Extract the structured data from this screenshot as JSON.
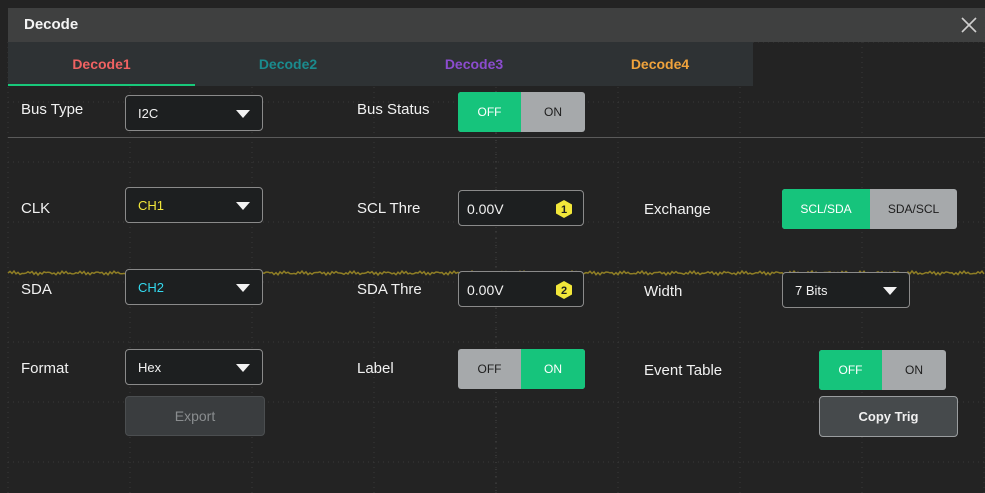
{
  "window": {
    "title": "Decode"
  },
  "tabs": [
    {
      "label": "Decode1",
      "color": "#f06262",
      "active": true
    },
    {
      "label": "Decode2",
      "color": "#1a8b8e",
      "active": false
    },
    {
      "label": "Decode3",
      "color": "#8c4ccf",
      "active": false
    },
    {
      "label": "Decode4",
      "color": "#f0a33c",
      "active": false
    }
  ],
  "rows": {
    "bus_type": {
      "label": "Bus Type",
      "value": "I2C"
    },
    "bus_status": {
      "label": "Bus Status",
      "off": "OFF",
      "on": "ON",
      "state": "OFF"
    },
    "clk": {
      "label": "CLK",
      "value": "CH1",
      "value_color": "#f2e73a"
    },
    "scl_thre": {
      "label": "SCL Thre",
      "value": "0.00V",
      "badge": "1",
      "badge_color": "#f2e73a"
    },
    "exchange": {
      "label": "Exchange",
      "opt1": "SCL/SDA",
      "opt2": "SDA/SCL",
      "state": "SCL/SDA"
    },
    "sda": {
      "label": "SDA",
      "value": "CH2",
      "value_color": "#33d9ee"
    },
    "sda_thre": {
      "label": "SDA Thre",
      "value": "0.00V",
      "badge": "2",
      "badge_color": "#f2e73a"
    },
    "width": {
      "label": "Width",
      "value": "7 Bits"
    },
    "format": {
      "label": "Format",
      "value": "Hex"
    },
    "label_opt": {
      "label": "Label",
      "off": "OFF",
      "on": "ON",
      "state": "ON"
    },
    "event_table": {
      "label": "Event Table",
      "off": "OFF",
      "on": "ON",
      "state": "OFF"
    },
    "export": {
      "label": "Export"
    },
    "copy_trig": {
      "label": "Copy Trig"
    }
  },
  "colors": {
    "accent_green": "#16c47c",
    "trace_yellow": "#9a8a2a"
  }
}
